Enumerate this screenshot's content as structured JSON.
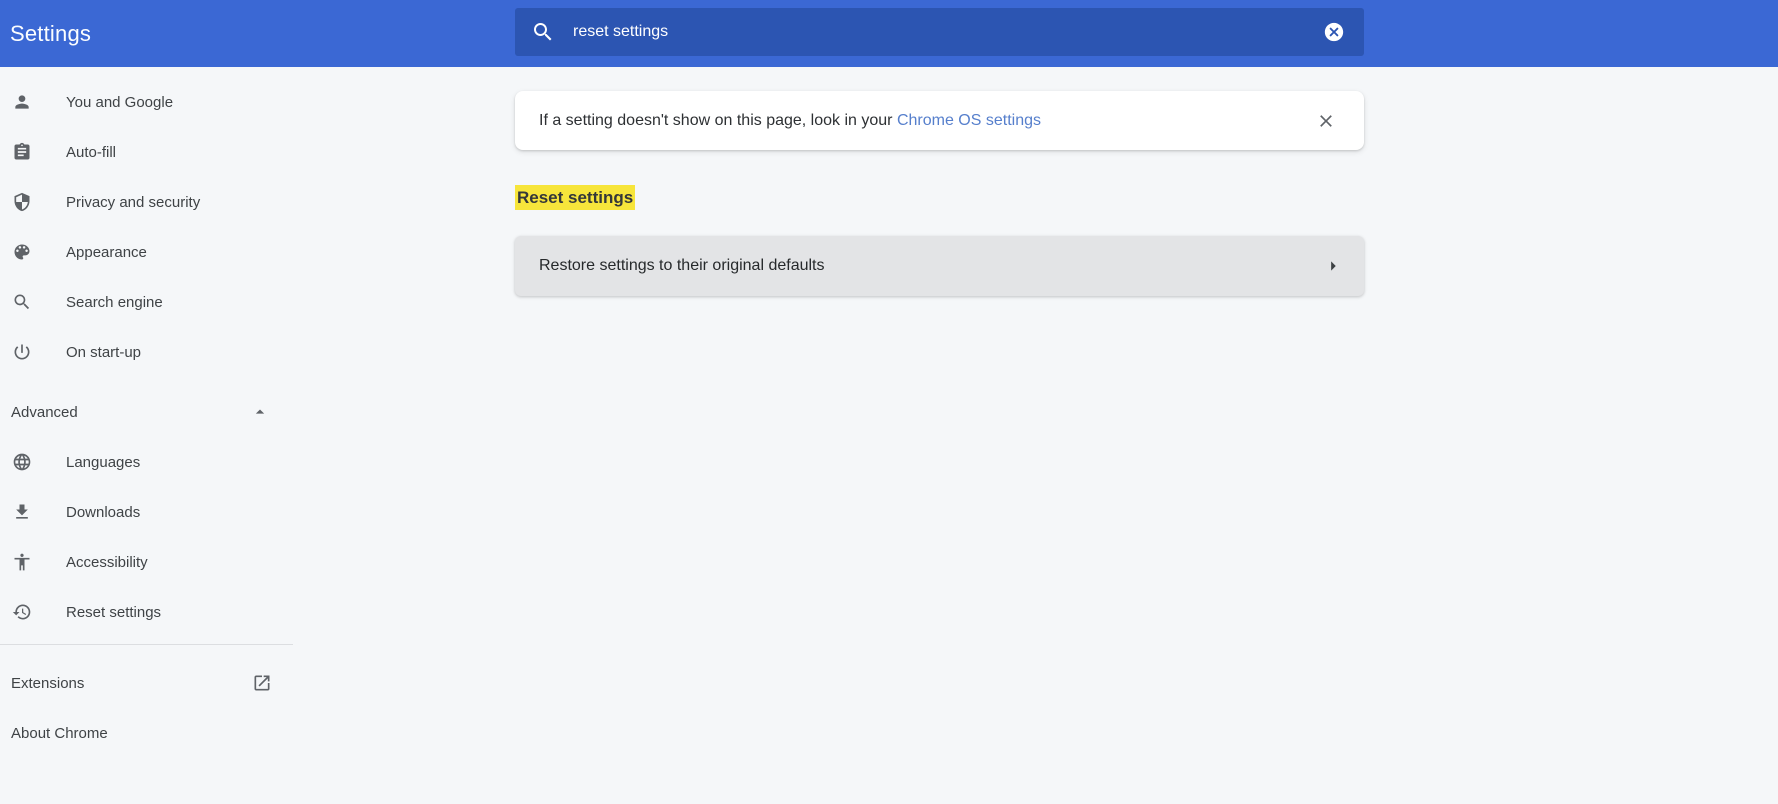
{
  "header": {
    "title": "Settings",
    "search": {
      "value": "reset settings",
      "icon": "search-icon",
      "clear_icon": "clear-circle-icon"
    }
  },
  "sidebar": {
    "items": [
      {
        "label": "You and Google",
        "icon": "person-icon"
      },
      {
        "label": "Auto-fill",
        "icon": "clipboard-icon"
      },
      {
        "label": "Privacy and security",
        "icon": "shield-icon"
      },
      {
        "label": "Appearance",
        "icon": "palette-icon"
      },
      {
        "label": "Search engine",
        "icon": "search-icon"
      },
      {
        "label": "On start-up",
        "icon": "power-icon"
      },
      {
        "label": "Languages",
        "icon": "globe-icon"
      },
      {
        "label": "Downloads",
        "icon": "download-icon"
      },
      {
        "label": "Accessibility",
        "icon": "accessibility-icon"
      },
      {
        "label": "Reset settings",
        "icon": "history-icon"
      }
    ],
    "advanced": {
      "label": "Advanced",
      "icon": "chevron-up-icon",
      "expanded": true
    },
    "footer_items": [
      {
        "label": "Extensions",
        "icon": "open-in-new-icon"
      },
      {
        "label": "About Chrome"
      }
    ]
  },
  "main": {
    "banner": {
      "text_before_link": "If a setting doesn't show on this page, look in your ",
      "link_text": "Chrome OS settings",
      "close_icon": "close-icon"
    },
    "section_heading": "Reset settings",
    "reset_row": {
      "label": "Restore settings to their original defaults",
      "icon": "arrow-right-icon"
    }
  },
  "colors": {
    "topbar": "#3b68d4",
    "searchbox": "#2c55b2",
    "page_background": "#f5f7f9",
    "highlight": "#f7e53b",
    "link": "#567fcc",
    "icon_gray": "#5f6368"
  }
}
